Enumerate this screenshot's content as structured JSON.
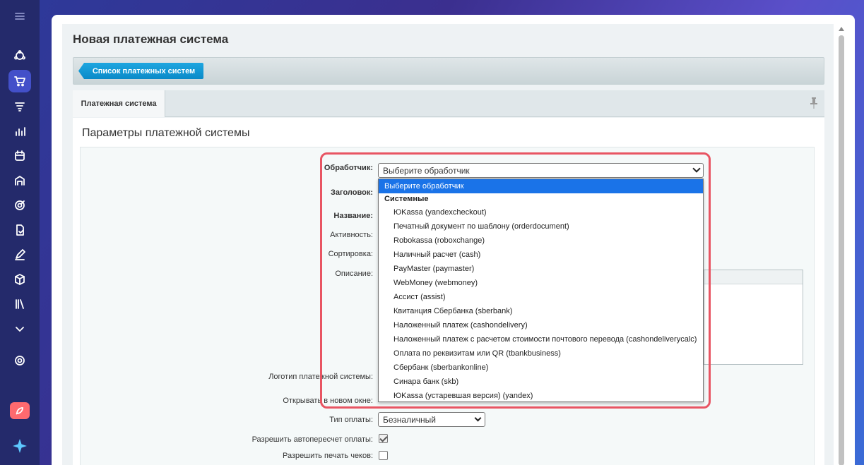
{
  "sidebar": {
    "icons": [
      "menu-icon",
      "contacts-icon",
      "cart-icon",
      "filter-icon",
      "analytics-icon",
      "calendar-icon",
      "warehouse-icon",
      "target-icon",
      "document-icon",
      "pen-icon",
      "box-icon",
      "library-icon",
      "chevron-down-icon",
      "settings-icon",
      "rocket-icon",
      "star-icon"
    ]
  },
  "page": {
    "title": "Новая платежная система",
    "list_button": "Список платежных систем",
    "tab_label": "Платежная система",
    "section_title": "Параметры платежной системы"
  },
  "form": {
    "handler_label": "Обработчик:",
    "handler_value": "Выберите обработчик",
    "header_label": "Заголовок:",
    "name_label": "Название:",
    "active_label": "Активность:",
    "sort_label": "Сортировка:",
    "description_label": "Описание:",
    "logo_label": "Логотип платежной системы:",
    "new_window_label": "Открывать в новом окне:",
    "pay_type_label": "Тип оплаты:",
    "pay_type_value": "Безналичный",
    "auto_recalc_label": "Разрешить автопересчет оплаты:",
    "auto_recalc_checked": true,
    "print_checks_label": "Разрешить печать чеков:",
    "print_checks_checked": false
  },
  "dropdown": {
    "selected": "Выберите обработчик",
    "group": "Системные",
    "items": [
      "ЮKassa (yandexcheckout)",
      "Печатный документ по шаблону (orderdocument)",
      "Robokassa (roboxchange)",
      "Наличный расчет (cash)",
      "PayMaster (paymaster)",
      "WebMoney (webmoney)",
      "Ассист (assist)",
      "Квитанция Сбербанка (sberbank)",
      "Наложенный платеж (cashondelivery)",
      "Наложенный платеж с расчетом стоимости почтового перевода (cashondeliverycalc)",
      "Оплата по реквизитам или QR (tbankbusiness)",
      "Сбербанк (sberbankonline)",
      "Синара банк (skb)",
      "ЮKassa (устаревшая версия) (yandex)"
    ]
  },
  "colors": {
    "accent": "#1a73e8",
    "highlight": "#e85563",
    "button": "#0a8ac8"
  }
}
